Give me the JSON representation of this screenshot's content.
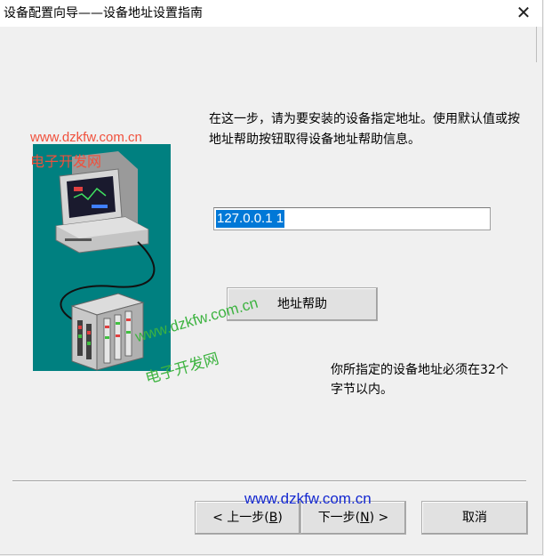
{
  "window": {
    "title": "设备配置向导——设备地址设置指南",
    "close_glyph": "✕"
  },
  "instruction_text": "在这一步，请为要安装的设备指定地址。使用默认值或按地址帮助按钮取得设备地址帮助信息。",
  "address_input": {
    "value": "127.0.0.1 1"
  },
  "help_button": {
    "label": "地址帮助"
  },
  "note_text": "你所指定的设备地址必须在32个字节以内。",
  "footer": {
    "back_prefix": "< 上一步(",
    "back_key": "B",
    "back_suffix": ")",
    "next_prefix": "下一步(",
    "next_key": "N",
    "next_suffix": ") >",
    "cancel_label": "取消"
  },
  "watermarks": {
    "wm1_url": "www.dzkfw.com.cn",
    "wm1_name": "电子开发网",
    "wm2_url": "www.dzkfw.com.cn",
    "wm2_name": "电子开发网",
    "wm3_url": "www.dzkfw.com.cn"
  },
  "colors": {
    "accent_teal": "#008080",
    "selection_blue": "#0078d7",
    "watermark_red": "#f0503c",
    "watermark_green": "#3db340",
    "watermark_blue": "#1428d0"
  },
  "icons": [
    "computer-icon",
    "network-device-icon",
    "close-icon"
  ]
}
